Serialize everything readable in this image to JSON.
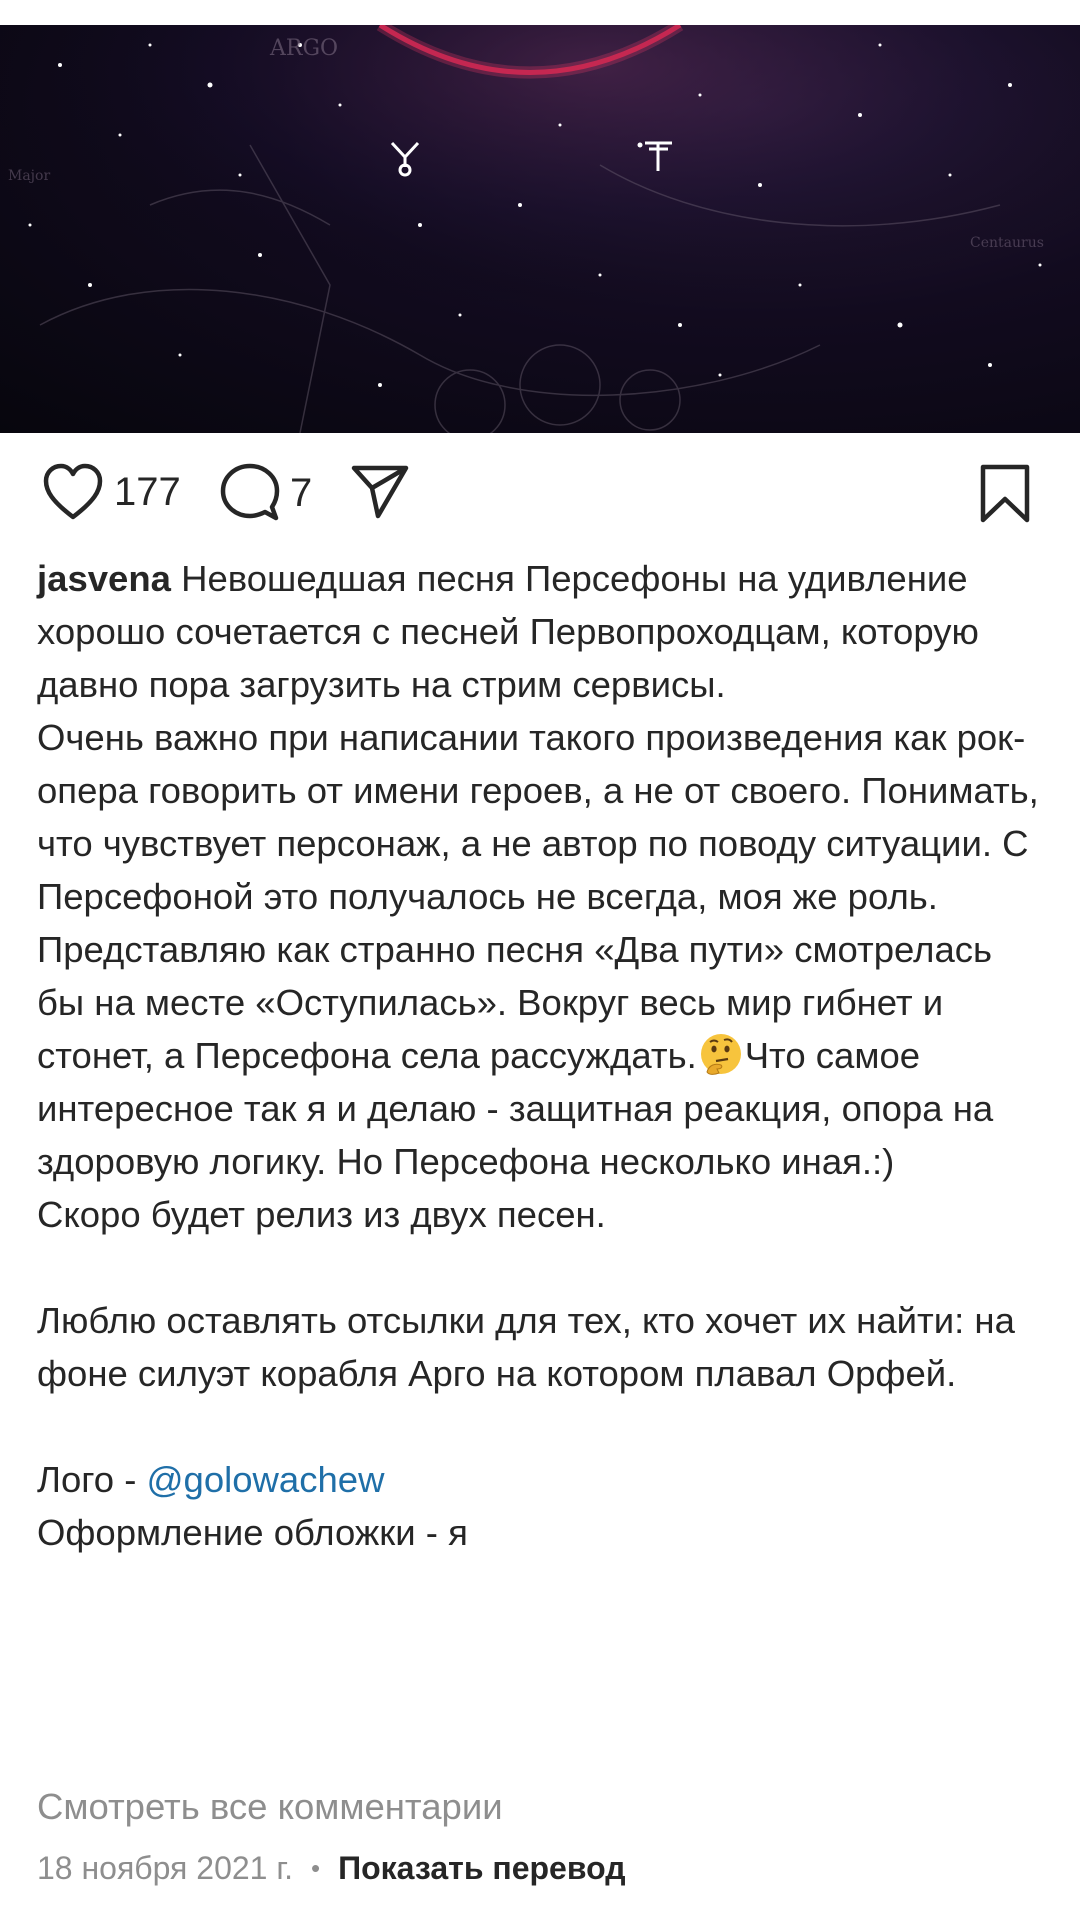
{
  "post": {
    "likes": "177",
    "comments": "7"
  },
  "caption": {
    "username": "jasvena",
    "line1": "Невошедшая песня Персефоны на удивление хорошо сочетается с песней Первопроходцам, которую давно пора загрузить на стрим сервисы.",
    "line2a": "Очень важно при написании такого произведения как рок-опера говорить от имени героев, а не от своего. Понимать, что чувствует персонаж, а не автор по поводу ситуации. С Персефоной это получалось не всегда, моя же роль. Представляю как странно песня «Два пути» смотрелась бы на месте «Оступилась». Вокруг весь мир гибнет и стонет, а Персефона села рассуждать.",
    "emoji": "🤔",
    "line2b": "Что самое интересное так я и делаю - защитная реакция, опора на здоровую логику. Но Персефона несколько иная.:)",
    "line3": "Скоро будет релиз из двух песен.",
    "line4": "Люблю оставлять отсылки для тех, кто хочет их найти: на фоне силуэт корабля Арго на котором плавал Орфей.",
    "logo_label": "Лого - ",
    "logo_mention": "@golowachew",
    "cover_line": "Оформление обложки - я"
  },
  "view_all_comments": "Смотреть все комментарии",
  "date": "18 ноября 2021 г.",
  "separator": "•",
  "show_translation": "Показать перевод",
  "colors": {
    "text": "#262626",
    "secondary": "#8e8e8e",
    "mention": "#1f6fa8",
    "arc": "#c0224a"
  },
  "icons": [
    "heart-icon",
    "comment-icon",
    "share-icon",
    "bookmark-icon",
    "thinking-face-emoji"
  ]
}
